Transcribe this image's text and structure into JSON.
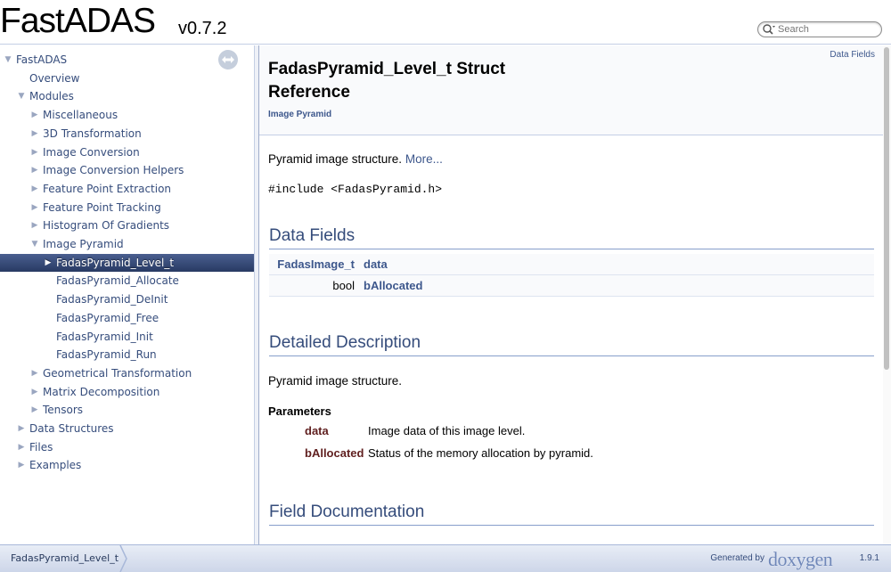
{
  "header": {
    "project_name": "FastADAS",
    "project_number": "v0.7.2",
    "search_placeholder": "Search"
  },
  "nav": {
    "items": [
      {
        "label": "FastADAS",
        "arrow": "▼",
        "indent": 0
      },
      {
        "label": "Overview",
        "arrow": "",
        "indent": 1
      },
      {
        "label": "Modules",
        "arrow": "▼",
        "indent": 1
      },
      {
        "label": "Miscellaneous",
        "arrow": "▶",
        "indent": 2
      },
      {
        "label": "3D Transformation",
        "arrow": "▶",
        "indent": 2
      },
      {
        "label": "Image Conversion",
        "arrow": "▶",
        "indent": 2
      },
      {
        "label": "Image Conversion Helpers",
        "arrow": "▶",
        "indent": 2
      },
      {
        "label": "Feature Point Extraction",
        "arrow": "▶",
        "indent": 2
      },
      {
        "label": "Feature Point Tracking",
        "arrow": "▶",
        "indent": 2
      },
      {
        "label": "Histogram Of Gradients",
        "arrow": "▶",
        "indent": 2
      },
      {
        "label": "Image Pyramid",
        "arrow": "▼",
        "indent": 2
      },
      {
        "label": "FadasPyramid_Level_t",
        "arrow": "▶",
        "indent": 3,
        "selected": true
      },
      {
        "label": "FadasPyramid_Allocate",
        "arrow": "",
        "indent": 3
      },
      {
        "label": "FadasPyramid_DeInit",
        "arrow": "",
        "indent": 3
      },
      {
        "label": "FadasPyramid_Free",
        "arrow": "",
        "indent": 3
      },
      {
        "label": "FadasPyramid_Init",
        "arrow": "",
        "indent": 3
      },
      {
        "label": "FadasPyramid_Run",
        "arrow": "",
        "indent": 3
      },
      {
        "label": "Geometrical Transformation",
        "arrow": "▶",
        "indent": 2
      },
      {
        "label": "Matrix Decomposition",
        "arrow": "▶",
        "indent": 2
      },
      {
        "label": "Tensors",
        "arrow": "▶",
        "indent": 2
      },
      {
        "label": "Data Structures",
        "arrow": "▶",
        "indent": 1
      },
      {
        "label": "Files",
        "arrow": "▶",
        "indent": 1
      },
      {
        "label": "Examples",
        "arrow": "▶",
        "indent": 1
      }
    ]
  },
  "page": {
    "title": "FadasPyramid_Level_t Struct Reference",
    "ingroup": "Image Pyramid",
    "summary_link": "Data Fields",
    "brief": "Pyramid image structure.",
    "more_link": "More...",
    "include": "#include <FadasPyramid.h>",
    "data_fields_heading": "Data Fields",
    "members": [
      {
        "type": "FadasImage_t",
        "type_is_link": true,
        "name": "data"
      },
      {
        "type": "bool",
        "type_is_link": false,
        "name": "bAllocated"
      }
    ],
    "detailed_heading": "Detailed Description",
    "detailed_text": "Pyramid image structure.",
    "params_title": "Parameters",
    "params": [
      {
        "name": "data",
        "desc": "Image data of this image level."
      },
      {
        "name": "bAllocated",
        "desc": "Status of the memory allocation by pyramid."
      }
    ],
    "field_doc_heading": "Field Documentation"
  },
  "footer": {
    "breadcrumb": "FadasPyramid_Level_t",
    "generated_by": "Generated by",
    "doxygen": "doxygen",
    "version": "1.9.1"
  },
  "colors": {
    "link": "#3d578c",
    "heading": "#354c7b",
    "param": "#602020",
    "selected_bg": "#283a63"
  }
}
